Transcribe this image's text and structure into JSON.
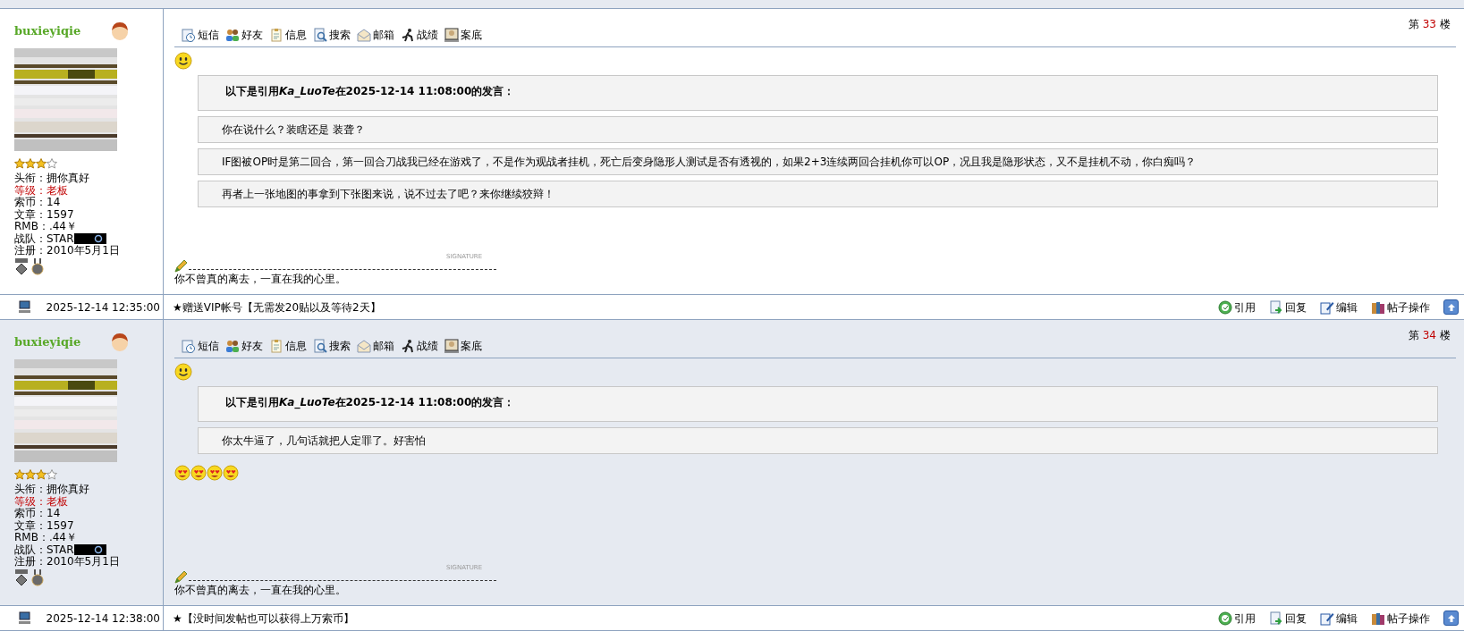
{
  "posts": [
    {
      "author": {
        "name": "buxieyiqie",
        "stars": 3,
        "info": [
          {
            "text": "头衔：拥你真好"
          },
          {
            "text": "等级：老板",
            "color": "#c00000"
          },
          {
            "text": "索币：14"
          },
          {
            "text": "文章：1597"
          },
          {
            "text": "RMB：.44￥"
          },
          {
            "text": "战队：STAR",
            "kind": "team"
          },
          {
            "text": "注册：2010年5月1日"
          }
        ]
      },
      "toolbar": [
        {
          "kind": "sms",
          "label": "短信"
        },
        {
          "kind": "friends",
          "label": "好友"
        },
        {
          "kind": "info",
          "label": "信息"
        },
        {
          "kind": "search",
          "label": "搜索"
        },
        {
          "kind": "mail",
          "label": "邮箱"
        },
        {
          "kind": "stats",
          "label": "战绩"
        },
        {
          "kind": "record",
          "label": "案底"
        }
      ],
      "floor_prefix": "第",
      "floor": "33",
      "floor_suffix": "楼",
      "mood": {
        "kind": "smile"
      },
      "quote": {
        "header_before": "以下是引用",
        "quoted_user": "Ka_LuoTe",
        "header_after": "在2025-12-14 11:08:00的发言：",
        "lines": [
          "你在说什么？装瞎还是 装聋？",
          "IF图被OP时是第二回合，第一回合刀战我已经在游戏了，不是作为观战者挂机，死亡后变身隐形人测试是否有透视的，如果2+3连续两回合挂机你可以OP，况且我是隐形状态，又不是挂机不动，你白痴吗？",
          "再者上一张地图的事拿到下张图来说，说不过去了吧？来你继续狡辩！"
        ]
      },
      "signature_label": "SIGNATURE",
      "signature": "你不曾真的离去，一直在我的心里。",
      "footer": {
        "time": "2025-12-14 12:35:00",
        "ad": "★赠送VIP帐号【无需发20贴以及等待2天】",
        "actions": [
          {
            "kind": "quote",
            "label": "引用"
          },
          {
            "kind": "reply",
            "label": "回复"
          },
          {
            "kind": "edit",
            "label": "编辑"
          },
          {
            "kind": "manage",
            "label": "帖子操作"
          }
        ]
      }
    },
    {
      "author": {
        "name": "buxieyiqie",
        "stars": 3,
        "info": [
          {
            "text": "头衔：拥你真好"
          },
          {
            "text": "等级：老板",
            "color": "#c00000"
          },
          {
            "text": "索币：14"
          },
          {
            "text": "文章：1597"
          },
          {
            "text": "RMB：.44￥"
          },
          {
            "text": "战队：STAR",
            "kind": "team"
          },
          {
            "text": "注册：2010年5月1日"
          }
        ]
      },
      "toolbar": [
        {
          "kind": "sms",
          "label": "短信"
        },
        {
          "kind": "friends",
          "label": "好友"
        },
        {
          "kind": "info",
          "label": "信息"
        },
        {
          "kind": "search",
          "label": "搜索"
        },
        {
          "kind": "mail",
          "label": "邮箱"
        },
        {
          "kind": "stats",
          "label": "战绩"
        },
        {
          "kind": "record",
          "label": "案底"
        }
      ],
      "floor_prefix": "第",
      "floor": "34",
      "floor_suffix": "楼",
      "mood": {
        "kind": "smile"
      },
      "quote": {
        "header_before": "以下是引用",
        "quoted_user": "Ka_LuoTe",
        "header_after": "在2025-12-14 11:08:00的发言：",
        "lines": [
          "你太牛逼了，几句话就把人定罪了。好害怕"
        ]
      },
      "emojis": [
        {
          "kind": "heart-eyes"
        },
        {
          "kind": "heart-eyes"
        },
        {
          "kind": "heart-eyes"
        },
        {
          "kind": "heart-eyes"
        }
      ],
      "signature_label": "SIGNATURE",
      "signature": "你不曾真的离去，一直在我的心里。",
      "footer": {
        "time": "2025-12-14 12:38:00",
        "ad": "★【没时间发帖也可以获得上万索币】",
        "actions": [
          {
            "kind": "quote",
            "label": "引用"
          },
          {
            "kind": "reply",
            "label": "回复"
          },
          {
            "kind": "edit",
            "label": "编辑"
          },
          {
            "kind": "manage",
            "label": "帖子操作"
          }
        ]
      }
    }
  ]
}
